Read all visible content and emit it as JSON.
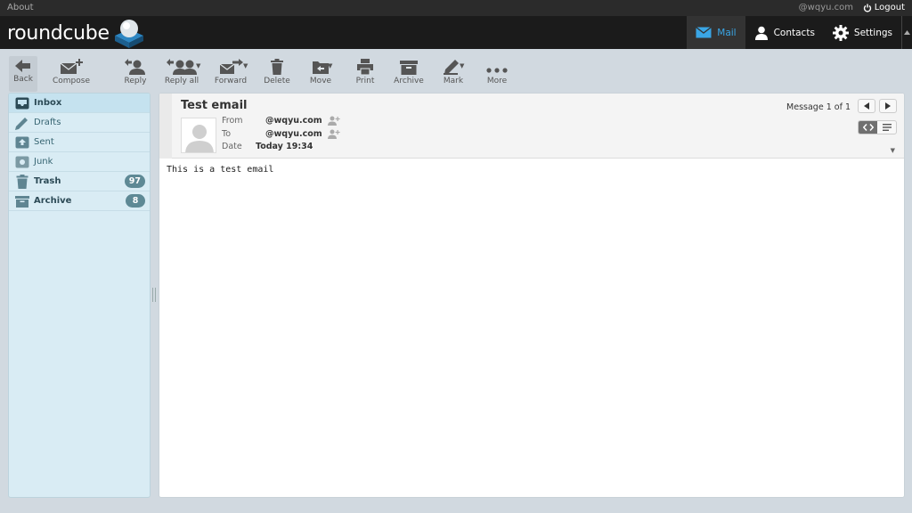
{
  "topbar": {
    "about": "About",
    "user": "@wqyu.com",
    "logout": "Logout"
  },
  "header": {
    "logo_text": "roundcube",
    "tasks": [
      {
        "label": "Mail",
        "icon": "mail-icon",
        "active": true
      },
      {
        "label": "Contacts",
        "icon": "contacts-icon",
        "active": false
      },
      {
        "label": "Settings",
        "icon": "gear-icon",
        "active": false
      }
    ]
  },
  "toolbar": {
    "back": "Back",
    "compose": "Compose",
    "reply": "Reply",
    "reply_all": "Reply all",
    "forward": "Forward",
    "delete": "Delete",
    "move": "Move",
    "print": "Print",
    "archive": "Archive",
    "mark": "Mark",
    "more": "More"
  },
  "folders": [
    {
      "name": "Inbox",
      "icon": "inbox-icon",
      "selected": true,
      "bold": true,
      "count": ""
    },
    {
      "name": "Drafts",
      "icon": "pencil-icon",
      "selected": false,
      "bold": false,
      "count": ""
    },
    {
      "name": "Sent",
      "icon": "sent-icon",
      "selected": false,
      "bold": false,
      "count": ""
    },
    {
      "name": "Junk",
      "icon": "junk-icon",
      "selected": false,
      "bold": false,
      "count": ""
    },
    {
      "name": "Trash",
      "icon": "trash-icon",
      "selected": false,
      "bold": true,
      "count": "97"
    },
    {
      "name": "Archive",
      "icon": "archive-icon",
      "selected": false,
      "bold": true,
      "count": "8"
    }
  ],
  "message": {
    "subject": "Test email",
    "from_label": "From",
    "from_value": "@wqyu.com",
    "to_label": "To",
    "to_value": "@wqyu.com",
    "date_label": "Date",
    "date_value": "Today 19:34",
    "counter": "Message 1 of 1",
    "body": "This is a test email"
  },
  "colors": {
    "accent": "#3aa6e6",
    "header_bg": "#1b1b1b",
    "folder_bg": "#d9ecf4",
    "badge": "#5e8995"
  }
}
